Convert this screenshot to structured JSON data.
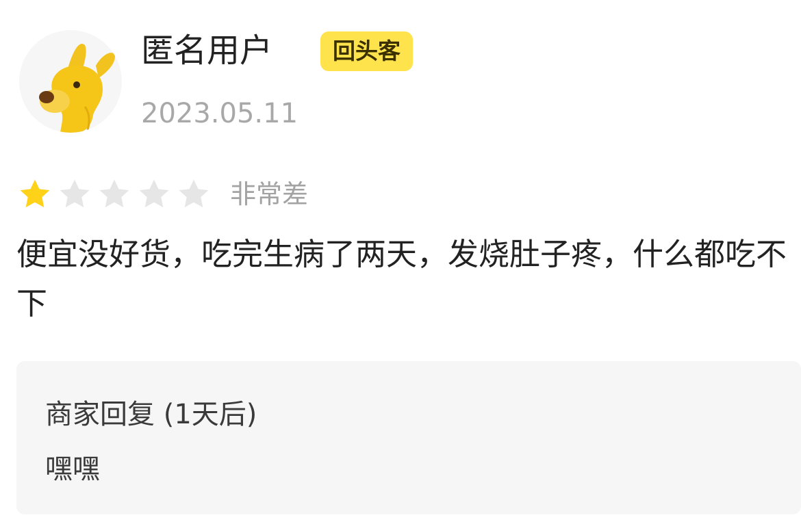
{
  "review": {
    "user": {
      "name": "匿名用户",
      "badge": "回头客",
      "avatar_icon": "yellow-dog-avatar-icon"
    },
    "date": "2023.05.11",
    "rating": {
      "value": 1,
      "max": 5,
      "label": "非常差",
      "filled_color": "#ffd21a",
      "empty_color": "#e6e6e6"
    },
    "content": "便宜没好货，吃完生病了两天，发烧肚子疼，什么都吃不下",
    "merchant_reply": {
      "title": "商家回复 (1天后)",
      "text": "嘿嘿"
    }
  },
  "colors": {
    "badge_bg": "#ffe34d",
    "reply_bg": "#f6f6f6"
  }
}
